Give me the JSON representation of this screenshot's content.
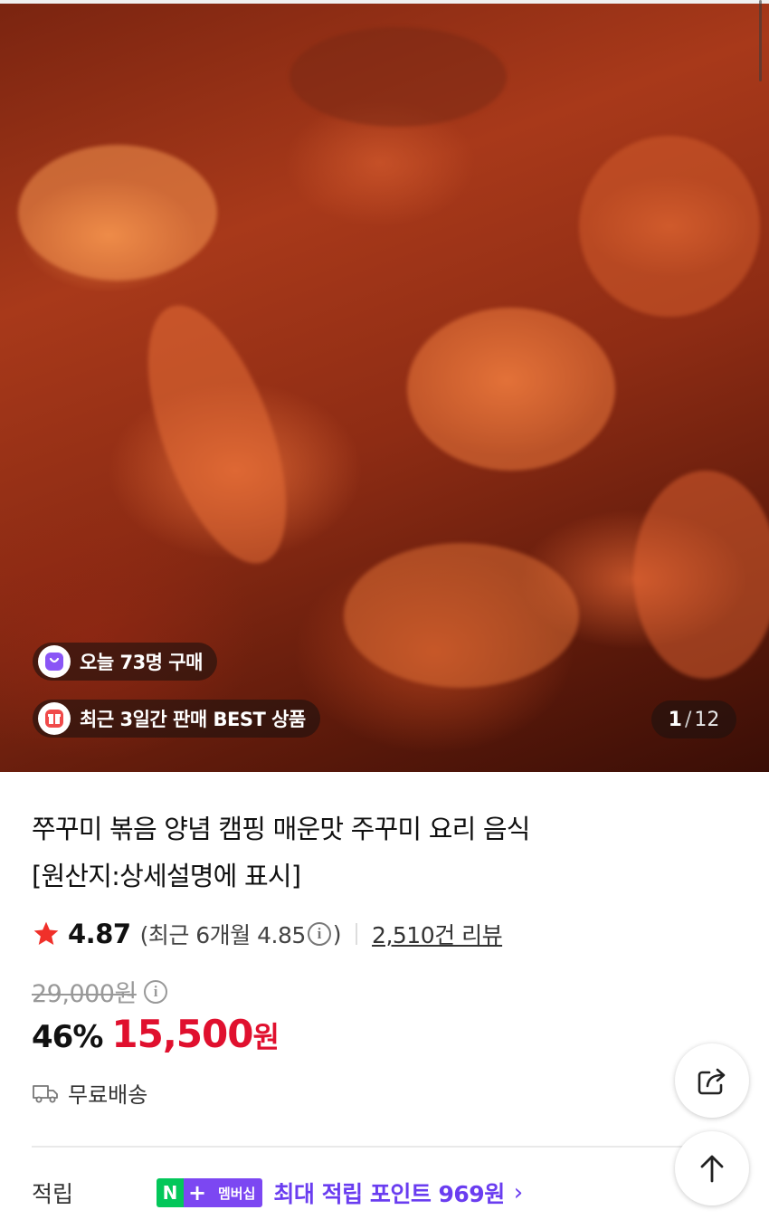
{
  "hero": {
    "image_alt": "쭈꾸미 볶음",
    "badges": [
      {
        "icon": "shopping-bag-icon",
        "text": "오늘 73명 구매"
      },
      {
        "icon": "gift-icon",
        "text": "최근 3일간 판매 BEST 상품"
      }
    ],
    "counter": {
      "current": "1",
      "total": "12"
    }
  },
  "product": {
    "title_line1": "쭈꾸미 볶음 양념 캠핑 매운맛 주꾸미 요리 음식",
    "title_line2": "[원산지:상세설명에 표시]"
  },
  "rating": {
    "score": "4.87",
    "recent_prefix": "(최근 6개월 4.85",
    "recent_suffix": ")",
    "reviews": "2,510건 리뷰"
  },
  "price": {
    "original": "29,000원",
    "discount": "46%",
    "sale_amount": "15,500",
    "currency": "원"
  },
  "shipping": {
    "text": "무료배송"
  },
  "points": {
    "label": "적립",
    "badge_n": "N",
    "badge_plus": "+",
    "badge_membership": "멤버십",
    "promo": "최대 적립 포인트 969원",
    "chevron": "›"
  },
  "colors": {
    "sale_red": "#e0102e",
    "npay_green": "#03c75a",
    "membership_purple": "#7c47f2"
  }
}
